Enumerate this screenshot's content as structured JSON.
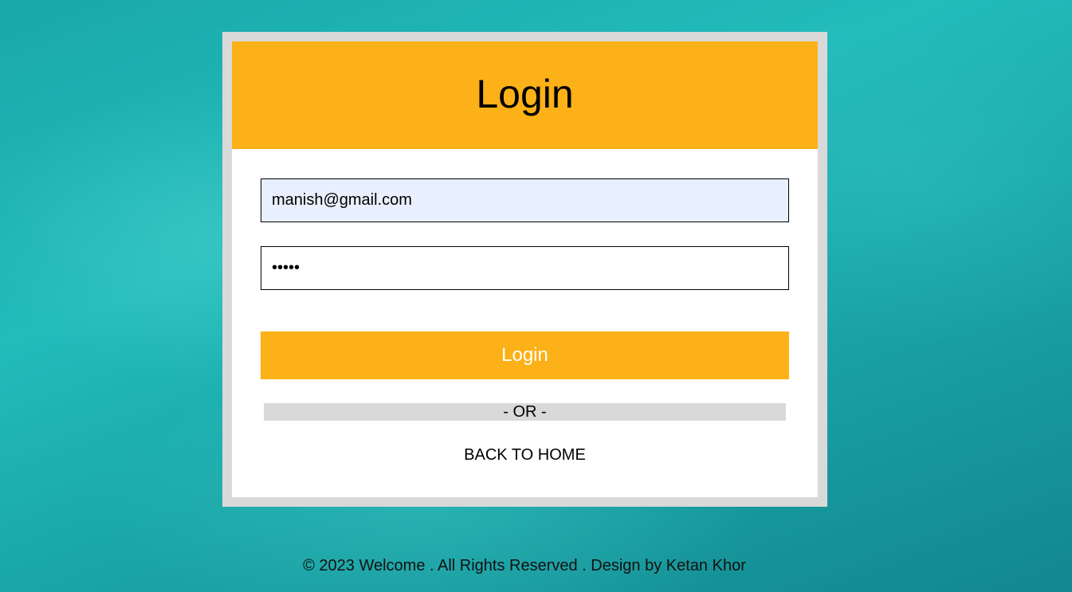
{
  "login": {
    "title": "Login",
    "email_value": "manish@gmail.com",
    "password_value": "•••••",
    "button_label": "Login",
    "divider_text": "- OR -",
    "back_link_label": "BACK TO HOME"
  },
  "footer": {
    "text": "© 2023 Welcome . All Rights Reserved . Design by Ketan Khor"
  },
  "colors": {
    "accent": "#fbb117",
    "frame": "#d9d9d9",
    "autofill_background": "#e8f0fe",
    "background_teal": "#1aa8aa"
  }
}
